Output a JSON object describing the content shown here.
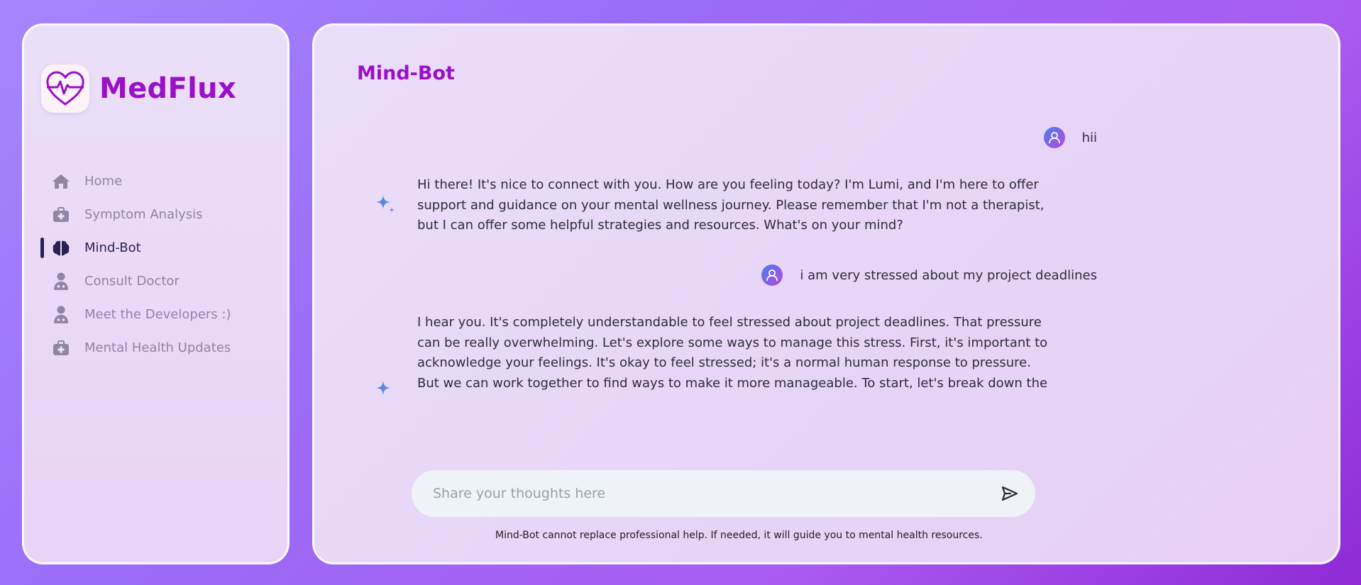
{
  "brand": {
    "name": "MedFlux",
    "logo_icon": "heart-pulse-icon"
  },
  "nav": {
    "items": [
      {
        "label": "Home",
        "icon": "home-icon",
        "active": false
      },
      {
        "label": "Symptom Analysis",
        "icon": "medical-kit-icon",
        "active": false
      },
      {
        "label": "Mind-Bot",
        "icon": "brain-icon",
        "active": true
      },
      {
        "label": "Consult Doctor",
        "icon": "doctor-icon",
        "active": false
      },
      {
        "label": "Meet the Developers :)",
        "icon": "doctor-icon",
        "active": false
      },
      {
        "label": "Mental Health Updates",
        "icon": "medical-kit-icon",
        "active": false
      }
    ]
  },
  "main": {
    "title": "Mind-Bot",
    "messages": [
      {
        "role": "user",
        "text": "hii"
      },
      {
        "role": "bot",
        "text": "Hi there! It's nice to connect with you. How are you feeling today? I'm Lumi, and I'm here to offer support and guidance on your mental wellness journey. Please remember that I'm not a therapist, but I can offer some helpful strategies and resources. What's on your mind?"
      },
      {
        "role": "user",
        "text": "i am very stressed about my project deadlines"
      },
      {
        "role": "bot",
        "text": "I hear you. It's completely understandable to feel stressed about project deadlines. That pressure can be really overwhelming. Let's explore some ways to manage this stress. First, it's important to acknowledge your feelings. It's okay to feel stressed; it's a normal human response to pressure. But we can work together to find ways to make it more manageable. To start, let's break down the stress. Can you tell me a"
      }
    ],
    "composer": {
      "placeholder": "Share your thoughts here",
      "value": "",
      "send_icon": "send-icon"
    },
    "disclaimer": "Mind-Bot cannot replace professional help. If needed, it will guide you to mental health resources."
  },
  "colors": {
    "accent": "#9a10c7",
    "nav_text": "#8f85a6",
    "nav_active": "#2a2350"
  }
}
